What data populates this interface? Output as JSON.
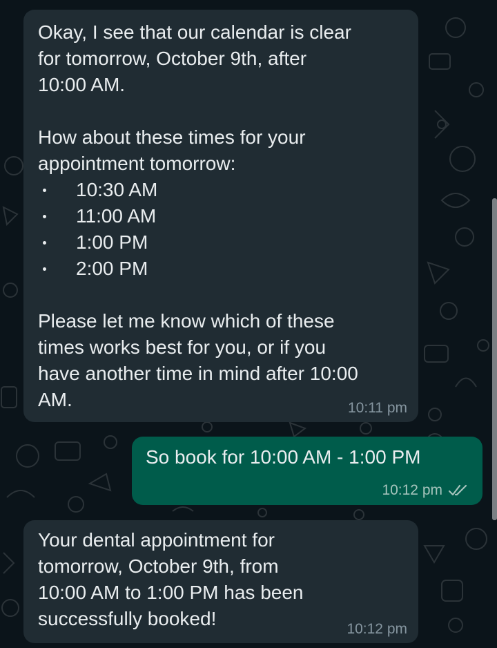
{
  "colors": {
    "background": "#0b141a",
    "incoming_bubble": "#202c33",
    "outgoing_bubble": "#005c4b",
    "text": "#e9edef",
    "timestamp": "#8696a0"
  },
  "messages": [
    {
      "direction": "incoming",
      "intro": [
        "Okay, I see that our calendar is clear",
        "for tomorrow, October 9th, after",
        "10:00 AM."
      ],
      "question": [
        "How about these times for your",
        "appointment tomorrow:"
      ],
      "options": [
        "10:30 AM",
        "11:00 AM",
        "1:00 PM",
        "2:00 PM"
      ],
      "closing": [
        "Please let me know which of these",
        "times works best for you, or if you",
        "have another time in mind after 10:00",
        "AM."
      ],
      "time": "10:11 pm"
    },
    {
      "direction": "outgoing",
      "text": "So book for 10:00 AM - 1:00 PM",
      "time": "10:12 pm",
      "status_icon": "double-check-icon"
    },
    {
      "direction": "incoming",
      "lines": [
        "Your dental appointment for",
        "tomorrow, October 9th, from",
        "10:00 AM to 1:00 PM has been",
        "successfully booked!"
      ],
      "time": "10:12 pm"
    }
  ]
}
